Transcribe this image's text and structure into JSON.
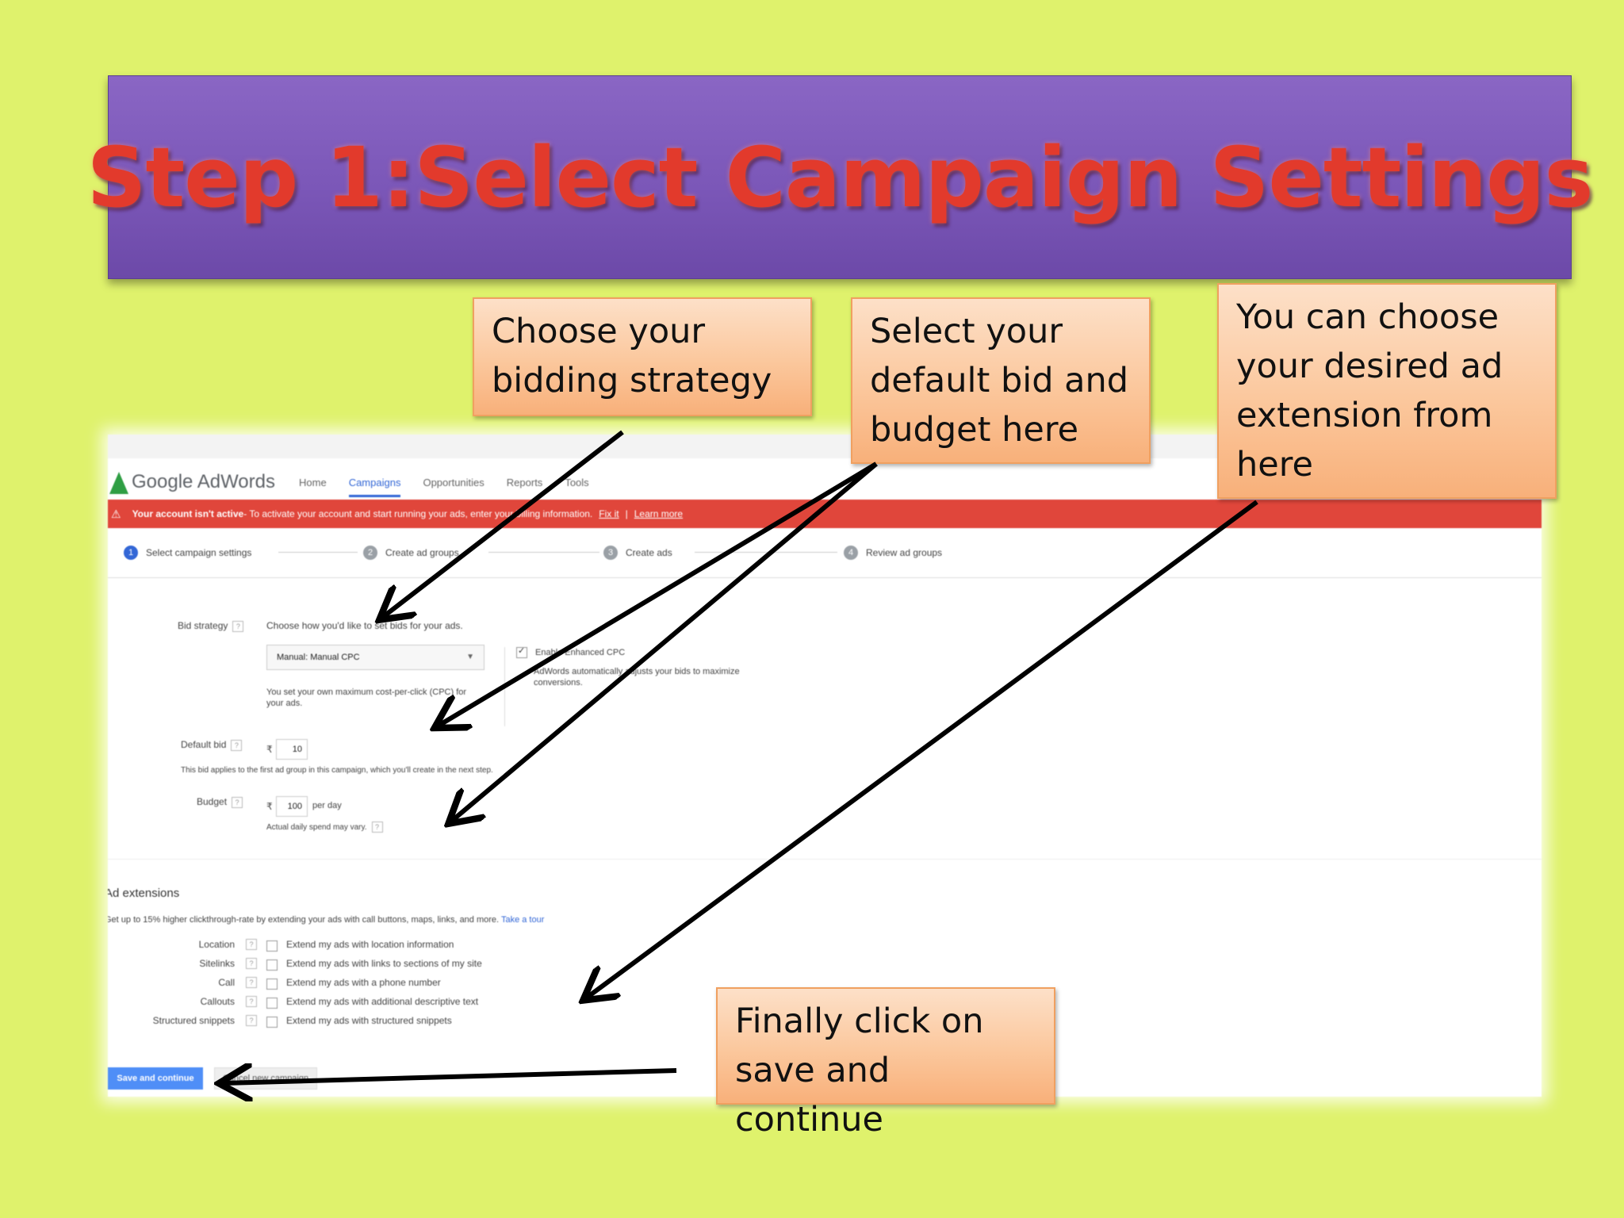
{
  "title": "Step 1:Select Campaign Settings",
  "callouts": {
    "bidding": "Choose your\nbidding strategy",
    "default_bid": "Select your\ndefault bid and\nbudget here",
    "extension": "You can choose\nyour desired ad\nextension from\nhere",
    "save": "Finally click on\nsave and continue"
  },
  "adwords": {
    "brand": "Google AdWords",
    "nav": [
      "Home",
      "Campaigns",
      "Opportunities",
      "Reports",
      "Tools"
    ],
    "alert": {
      "bold": "Your account isn't active",
      "text": " - To activate your account and start running your ads, enter your billing information.",
      "fix": "Fix it",
      "learn": "Learn more"
    },
    "steps": [
      "Select campaign settings",
      "Create ad groups",
      "Create ads",
      "Review ad groups"
    ],
    "step_numbers": [
      "1",
      "2",
      "3",
      "4"
    ],
    "bid_strategy": {
      "label": "Bid strategy",
      "help": "?",
      "prompt": "Choose how you'd like to set bids for your ads.",
      "selected": "Manual: Manual CPC",
      "description": "You set your own maximum cost-per-click (CPC) for your ads.",
      "enhanced_label": "Enable Enhanced CPC",
      "enhanced_desc": "AdWords automatically adjusts your bids to maximize conversions."
    },
    "default_bid": {
      "label": "Default bid",
      "currency": "₹",
      "value": "10",
      "note": "This bid applies to the first ad group in this campaign, which you'll create in the next step."
    },
    "budget": {
      "label": "Budget",
      "currency": "₹",
      "value": "100",
      "unit": "per day",
      "note": "Actual daily spend may vary."
    },
    "ad_extensions": {
      "heading": "Ad extensions",
      "intro": "Get up to 15% higher clickthrough-rate by extending your ads with call buttons, maps, links, and more.",
      "tour": "Take a tour",
      "rows": [
        {
          "name": "Location",
          "desc": "Extend my ads with location information"
        },
        {
          "name": "Sitelinks",
          "desc": "Extend my ads with links to sections of my site"
        },
        {
          "name": "Call",
          "desc": "Extend my ads with a phone number"
        },
        {
          "name": "Callouts",
          "desc": "Extend my ads with additional descriptive text"
        },
        {
          "name": "Structured snippets",
          "desc": "Extend my ads with structured snippets"
        }
      ]
    },
    "buttons": {
      "save": "Save and continue",
      "cancel": "Cancel new campaign"
    }
  }
}
